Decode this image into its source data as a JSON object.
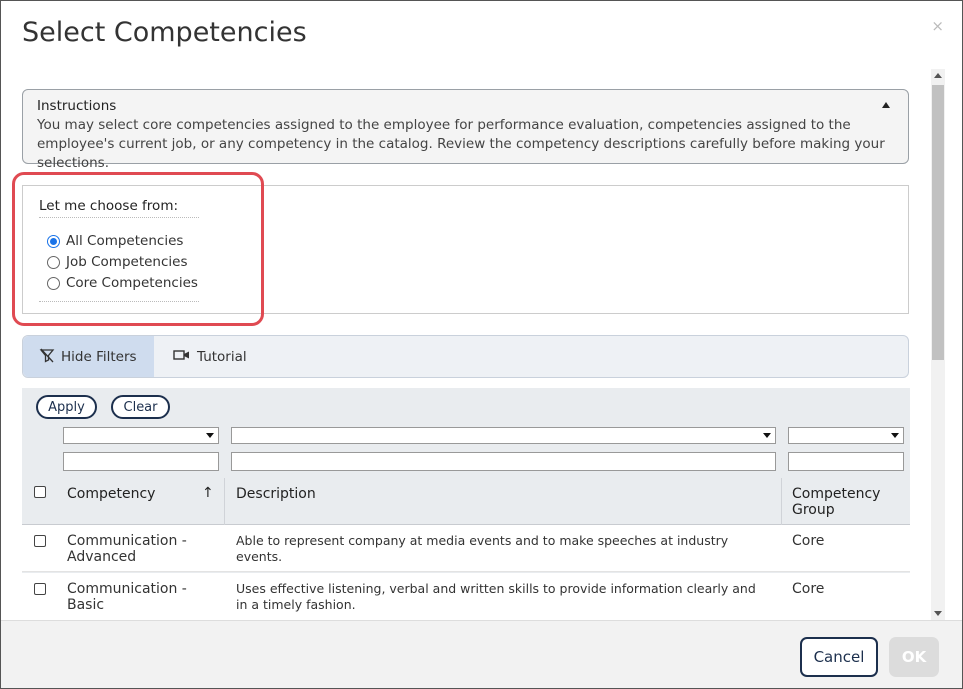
{
  "dialog": {
    "title": "Select Competencies",
    "close": "×"
  },
  "instructions": {
    "heading": "Instructions",
    "text": "You may select core competencies assigned to the employee for performance evaluation, competencies assigned to the employee's current job, or any competency in the catalog. Review the competency descriptions carefully before making your selections."
  },
  "choose": {
    "label": "Let me choose from:",
    "options": [
      {
        "label": "All Competencies",
        "checked": true
      },
      {
        "label": "Job Competencies",
        "checked": false
      },
      {
        "label": "Core Competencies",
        "checked": false
      }
    ]
  },
  "toolbar": {
    "hide_filters": "Hide Filters",
    "tutorial": "Tutorial"
  },
  "grid": {
    "apply": "Apply",
    "clear": "Clear",
    "columns": {
      "competency": "Competency",
      "sort_indicator": "↑",
      "description": "Description",
      "group_line1": "Competency",
      "group_line2": "Group"
    },
    "rows": [
      {
        "competency_l1": "Communication -",
        "competency_l2": "Advanced",
        "description": "Able to represent company at media events and to make speeches at industry events.",
        "group": "Core"
      },
      {
        "competency_l1": "Communication -",
        "competency_l2": "Basic",
        "description": "Uses effective listening, verbal and written skills to provide information clearly and in a timely fashion.",
        "group": "Core"
      }
    ]
  },
  "footer": {
    "cancel": "Cancel",
    "ok": "OK"
  }
}
